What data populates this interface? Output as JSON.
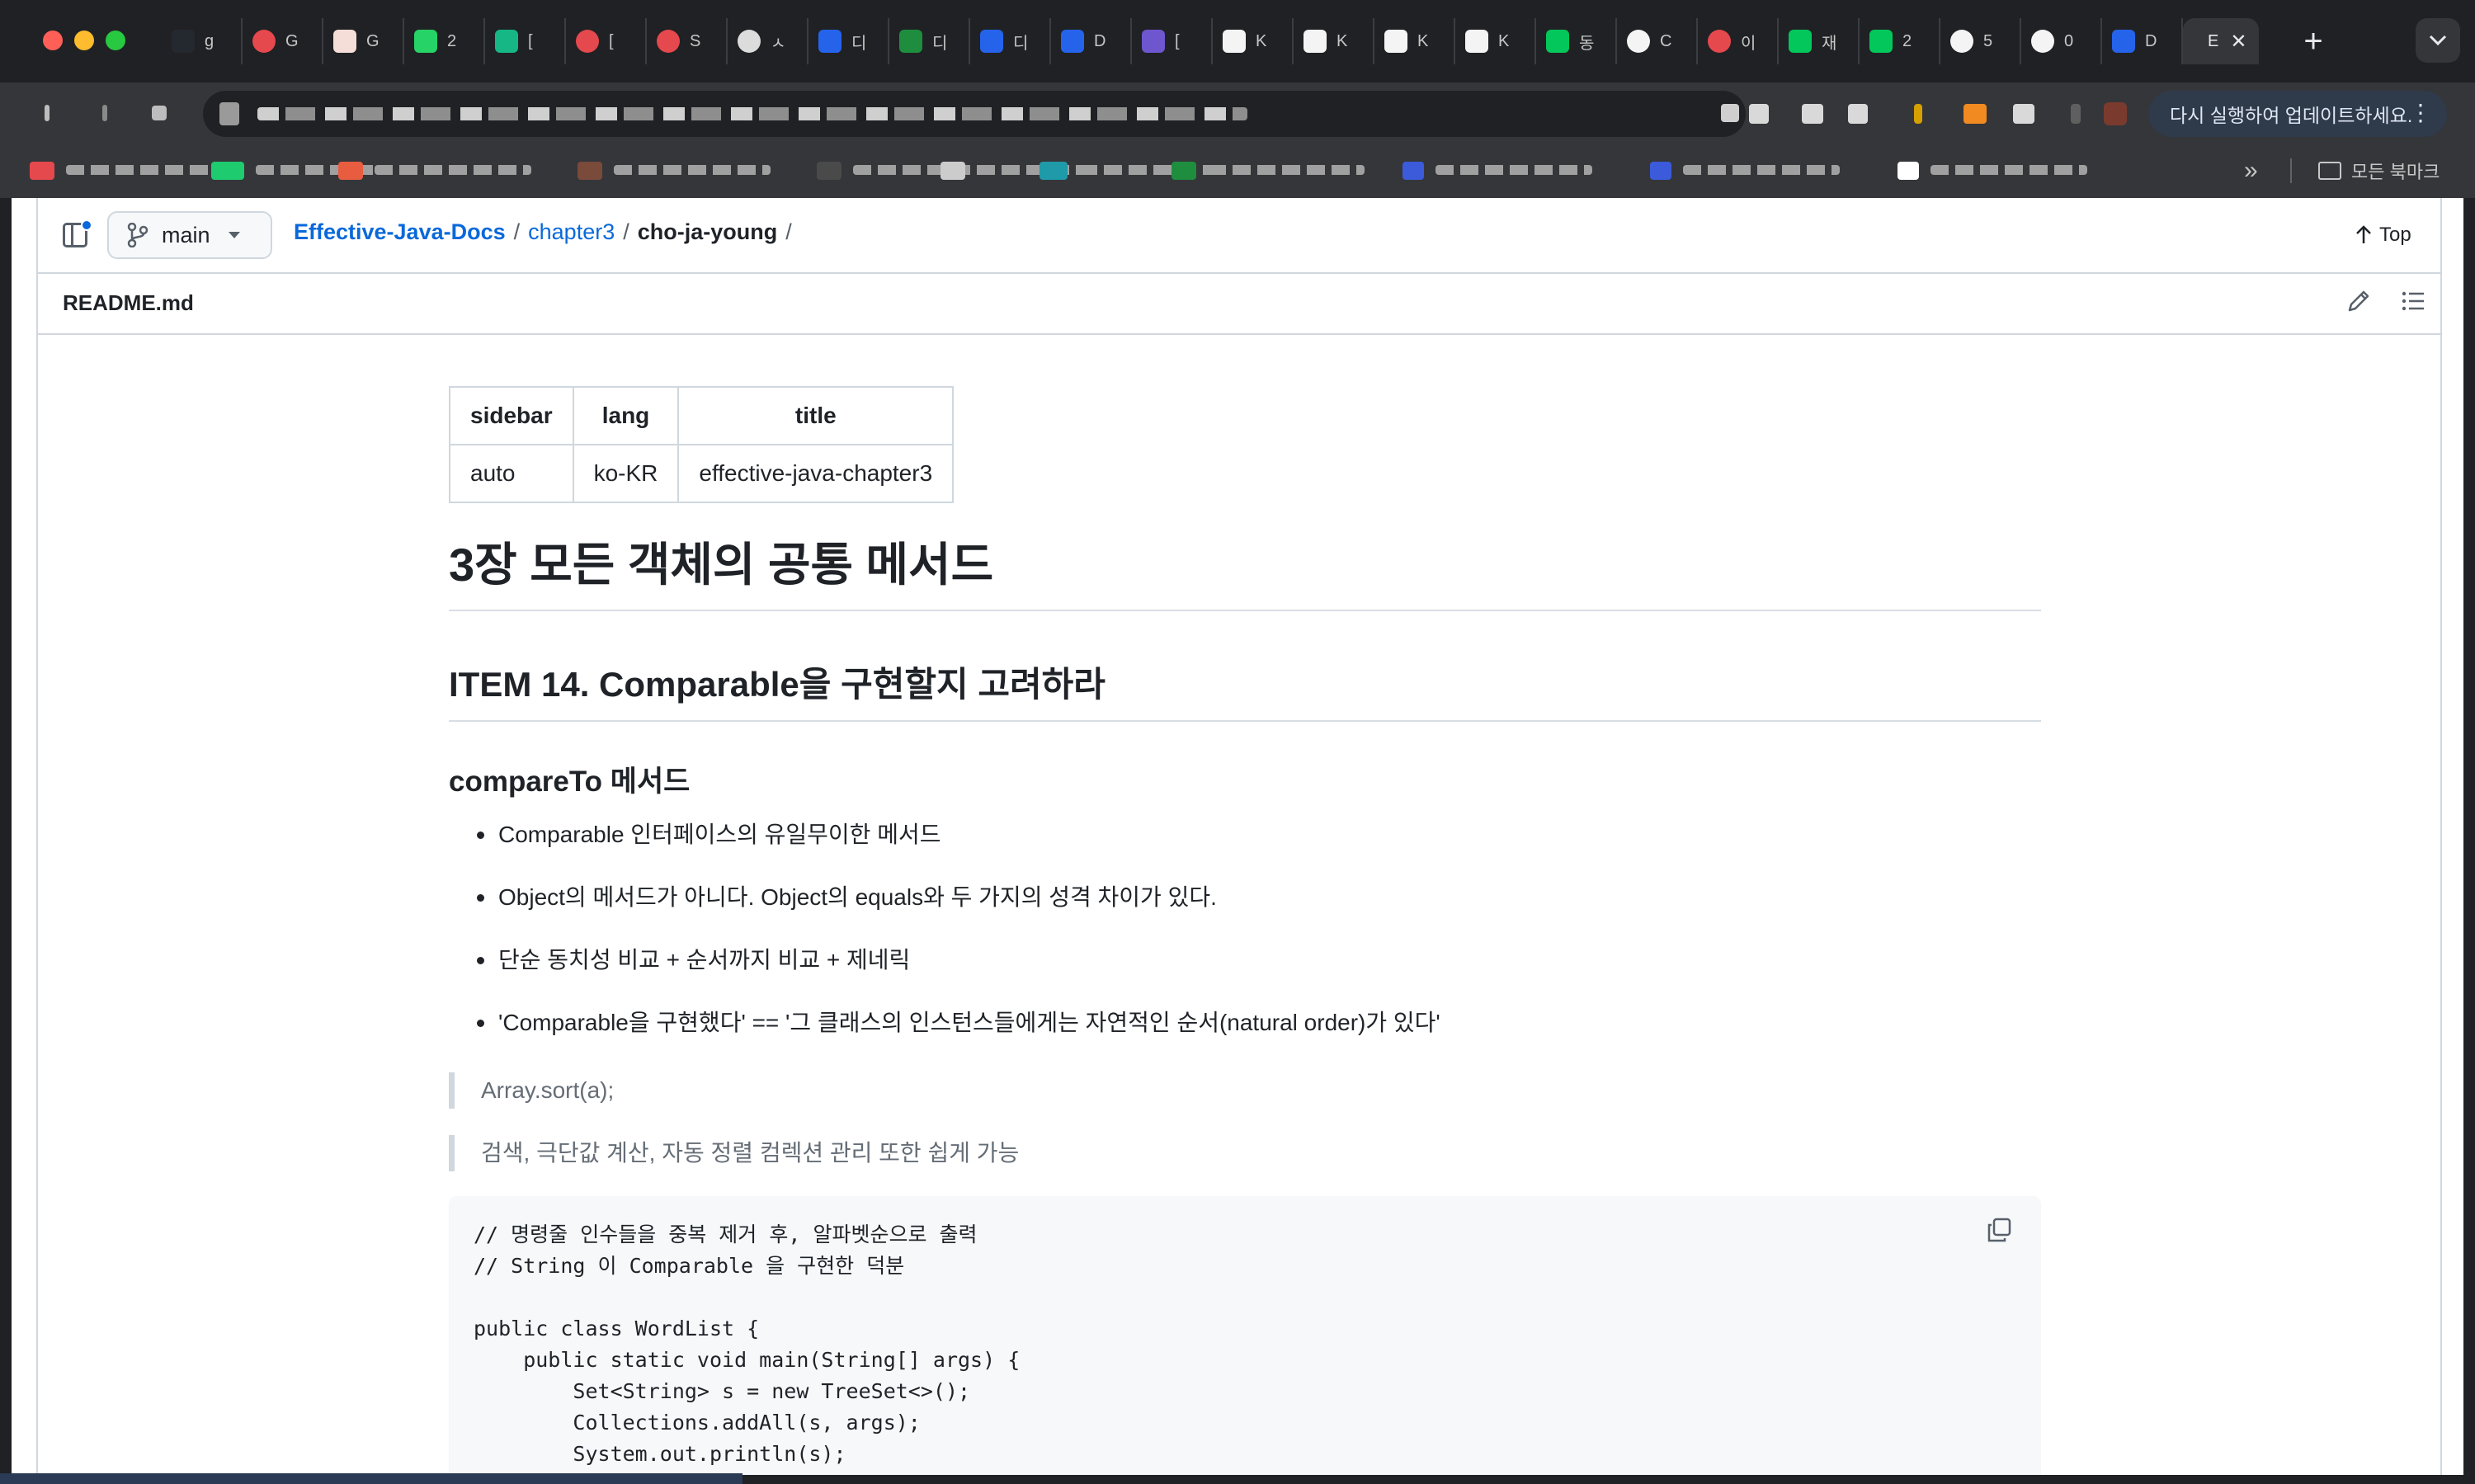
{
  "browser": {
    "tabs": [
      {
        "label": "g",
        "icon": "github-icon",
        "color": "#24292f"
      },
      {
        "label": "G",
        "icon": "red-circle-icon",
        "color": "#e5484d"
      },
      {
        "label": "G",
        "icon": "figma-icon",
        "color": "#f5ddd8"
      },
      {
        "label": "2",
        "icon": "whatsapp-icon",
        "color": "#25d366"
      },
      {
        "label": "[",
        "icon": "v-icon",
        "color": "#16b685"
      },
      {
        "label": "[",
        "icon": "red-circle-icon",
        "color": "#e5484d"
      },
      {
        "label": "S",
        "icon": "red-circle-icon",
        "color": "#e5484d"
      },
      {
        "label": "ㅅ",
        "icon": "chrome-icon",
        "color": "#dcdcdc"
      },
      {
        "label": "디",
        "icon": "d-logo-icon",
        "color": "#2563eb"
      },
      {
        "label": "디",
        "icon": "green-plus-icon",
        "color": "#1e8e3e"
      },
      {
        "label": "디",
        "icon": "d-logo-icon",
        "color": "#2563eb"
      },
      {
        "label": "D",
        "icon": "d-logo-icon",
        "color": "#2563eb"
      },
      {
        "label": "[",
        "icon": "list-icon",
        "color": "#6e56cf"
      },
      {
        "label": "K",
        "icon": "k-logo-icon",
        "color": "#f4f4f4"
      },
      {
        "label": "K",
        "icon": "k-logo-icon",
        "color": "#f4f4f4"
      },
      {
        "label": "K",
        "icon": "k-logo-icon",
        "color": "#f4f4f4"
      },
      {
        "label": "K",
        "icon": "k-logo-icon",
        "color": "#f4f4f4"
      },
      {
        "label": "동",
        "icon": "naver-icon",
        "color": "#03c75a"
      },
      {
        "label": "C",
        "icon": "openai-icon",
        "color": "#f4f4f4"
      },
      {
        "label": "이",
        "icon": "red-circle-icon",
        "color": "#e5484d"
      },
      {
        "label": "재",
        "icon": "naver-icon",
        "color": "#03c75a"
      },
      {
        "label": "2",
        "icon": "blog-icon",
        "color": "#03c75a"
      },
      {
        "label": "5",
        "icon": "google-icon",
        "color": "#f4f4f4"
      },
      {
        "label": "0",
        "icon": "google-icon",
        "color": "#f4f4f4"
      },
      {
        "label": "D",
        "icon": "d-logo-icon",
        "color": "#2563eb"
      }
    ],
    "active_tab": {
      "label": "E"
    },
    "update_prompt": "다시 실행하여 업데이트하세요.",
    "all_bookmarks": "모든 북마크"
  },
  "repo": {
    "branch": "main",
    "breadcrumb": {
      "repo": "Effective-Java-Docs",
      "folder": "chapter3",
      "current": "cho-ja-young",
      "sep": "/"
    },
    "top_label": "Top",
    "file_name": "README.md"
  },
  "readme": {
    "front_matter": {
      "headers": [
        "sidebar",
        "lang",
        "title"
      ],
      "values": [
        "auto",
        "ko-KR",
        "effective-java-chapter3"
      ]
    },
    "h1": "3장 모든 객체의 공통 메서드",
    "h2": "ITEM 14. Comparable을 구현할지 고려하라",
    "h3": "compareTo 메서드",
    "bullets": [
      "Comparable 인터페이스의 유일무이한 메서드",
      "Object의 메서드가 아니다. Object의 equals와 두 가지의 성격 차이가 있다.",
      "단순 동치성 비교 + 순서까지 비교 + 제네릭",
      "'Comparable을 구현했다' == '그 클래스의 인스턴스들에게는 자연적인 순서(natural order)가 있다'"
    ],
    "quotes": [
      "Array.sort(a);",
      "검색, 극단값 계산, 자동 정렬 컴렉션 관리 또한 쉽게 가능"
    ],
    "code": "// 명령줄 인수들을 중복 제거 후, 알파벳순으로 출력\n// String 이 Comparable 을 구현한 덕분\n\npublic class WordList {\n    public static void main(String[] args) {\n        Set<String> s = new TreeSet<>();\n        Collections.addAll(s, args);\n        System.out.println(s);"
  }
}
